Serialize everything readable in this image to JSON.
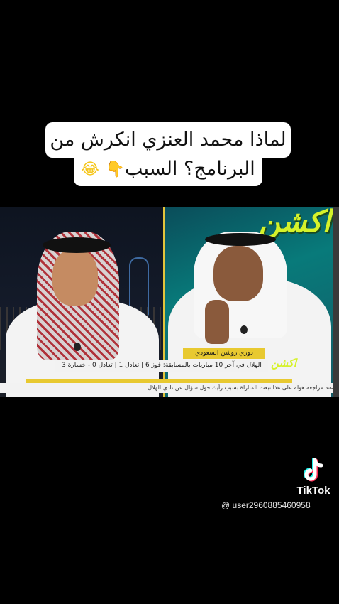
{
  "caption": {
    "line1": "لماذا محمد العنزي انكرش من",
    "line2_text": "البرنامج؟ السبب",
    "emoji_hand": "👇",
    "emoji_laugh": "😂"
  },
  "broadcast": {
    "logo_text": "اكشن",
    "name_tag": "دوري روشن السعودي",
    "ticker_main": "الهلال في آخر 10 مباريات بالمسابقة: فوز 6 | تعادل 1 | تعادل 0 - خسارة 3",
    "ticker_sub": "عند مراجعة هولة على هذا نبعث المباراة بسبب رأيك حول سؤال عن نادي الهلال"
  },
  "watermark": {
    "brand": "TikTok",
    "username": "@ user2960885460958"
  },
  "colors": {
    "background": "#000000",
    "caption_bg": "#ffffff",
    "ticker_accent": "#e8c930",
    "logo_green": "#d5f22a"
  }
}
